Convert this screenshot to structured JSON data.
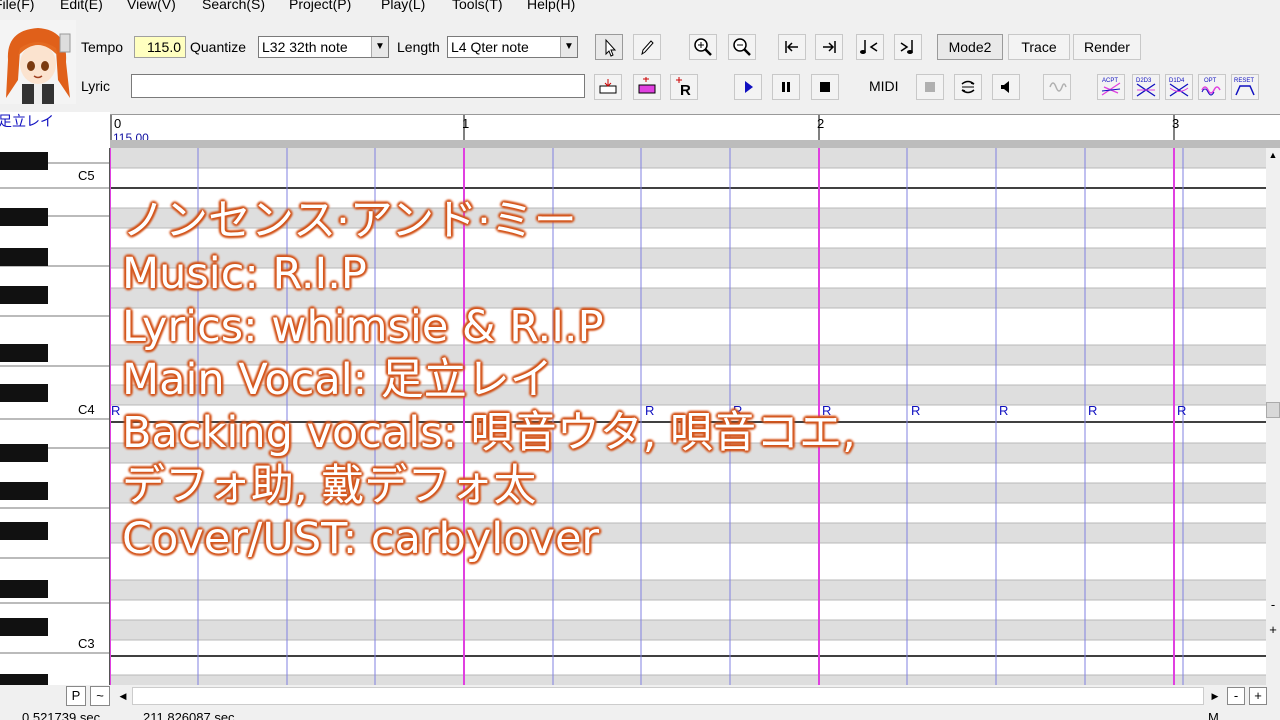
{
  "menu": [
    "File(F)",
    "Edit(E)",
    "View(V)",
    "Search(S)",
    "Project(P)",
    "Play(L)",
    "Tools(T)",
    "Help(H)"
  ],
  "toolbar": {
    "tempo_label": "Tempo",
    "tempo_value": "115.0",
    "quantize_label": "Quantize",
    "quantize_value": "L32 32th note",
    "length_label": "Length",
    "length_value": "L4  Qter note",
    "lyric_label": "Lyric",
    "lyric_value": "",
    "mode2": "Mode2",
    "trace": "Trace",
    "render": "Render",
    "midi": "MIDI"
  },
  "fx_buttons": [
    "ACPT",
    "D2D3",
    "D1D4",
    "OPT",
    "RESET"
  ],
  "track": {
    "name": "足立レイ",
    "tempo_mark": "115.00",
    "measures": [
      "0",
      "1",
      "2",
      "3"
    ],
    "rest_symbol": "R"
  },
  "keyboard_labels": {
    "c5": "C5",
    "c4": "C4",
    "c3": "C3"
  },
  "scroll": {
    "p_button": "P",
    "tilde_button": "~",
    "minus": "-",
    "plus": "+"
  },
  "status": {
    "left": "0.521739 sec",
    "right": "211.826087 sec",
    "mode": "M"
  },
  "credits": [
    "ノンセンス·アンド·ミー",
    "Music: R.I.P",
    "Lyrics: whimsie & R.I.P",
    "Main Vocal: 足立レイ",
    "Backing vocals: 唄音ウタ, 唄音コエ,",
    "デフォ助, 戴デフォ太",
    "Cover/UST: carbylover"
  ],
  "colors": {
    "measure_line": "#e040e0",
    "beat_line": "#8080e0",
    "credit_outline": "#d9581e",
    "tempo_box": "#ffffc0"
  }
}
